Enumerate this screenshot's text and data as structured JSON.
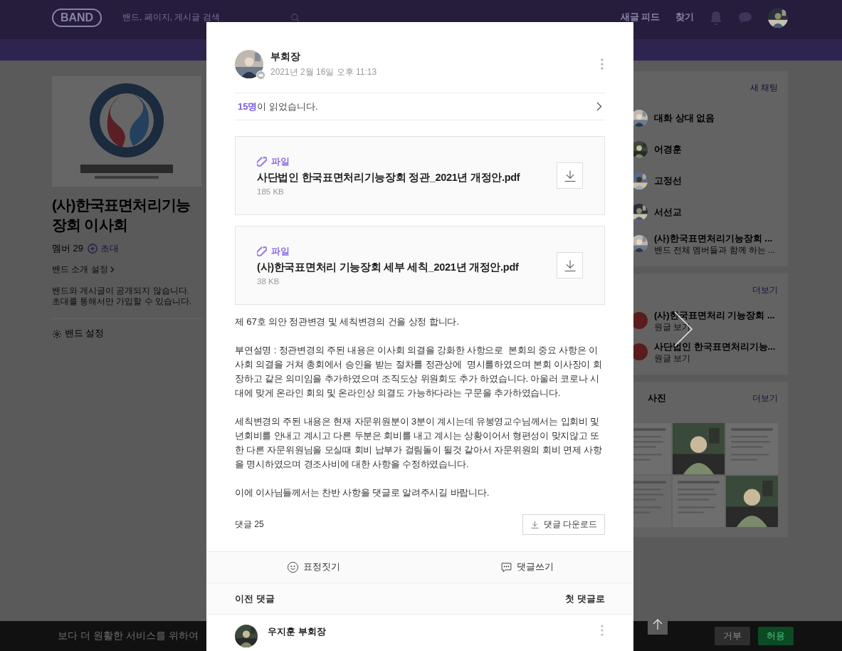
{
  "header": {
    "logo": "BAND",
    "search_placeholder": "밴드, 페이지, 게시글 검색",
    "nav": [
      "새글 피드",
      "찾기"
    ]
  },
  "band": {
    "name": "(사)한국표면처리기능장회 이사회",
    "members": "멤버 29",
    "invite": "초대",
    "intro_link": "밴드 소개 설정",
    "notice": [
      "밴드와 게시글이 공개되지 않습니다.",
      "초대를 통해서만 가입할 수 있습니다."
    ],
    "settings": "밴드 설정"
  },
  "chat": {
    "action": "새 채팅",
    "items": [
      {
        "name": "대화 상대 없음"
      },
      {
        "name": "어경훈"
      },
      {
        "name": "고정선"
      },
      {
        "name": "서선교"
      },
      {
        "name": "(사)한국표면처리기능장회 ...",
        "subtitle": "밴드 전체 멤버들과 함께 하는 ..."
      }
    ]
  },
  "files": {
    "action": "더보기",
    "items": [
      {
        "name": "(사)한국표면처리 기능장회 ...",
        "subtitle": "원글 보기"
      },
      {
        "name": "사단법인 한국표면처리기능...",
        "subtitle": "원글 보기"
      }
    ]
  },
  "photos": {
    "title": "사진",
    "action": "더보기"
  },
  "post": {
    "author": "부회장",
    "date": "2021년 2월 16일 오후 11:13",
    "read_by": "**15명**이 읽었습니다.",
    "files": [
      {
        "label": "파일",
        "name": "사단법인 한국표면처리기능장회 정관_2021년 개정안.pdf",
        "size": "185 KB"
      },
      {
        "label": "파일",
        "name": "(사)한국표면처리 기능장회 세부 세칙_2021년 개정안.pdf",
        "size": "38 KB"
      }
    ],
    "body": [
      "제 67호 의안 정관변경 및 세칙변경의 건을 상정 합니다.",
      "부연설명 : 정관변경의 주된 내용은 이사회 의결을 강화한 사항으로  본회의 중요 사항은 이사회 의결을 거쳐 총회에서 승인을 받는 절차를 정관상에  명시를하였으며 본회 이사장이 회장하고 같은 의미임을 추가하였으며 조직도상 위원회도 추가 하였습니다. 아울러 코로나 시대에 맞게 온라인 회의 및 온라인상 의결도 가능하다라는 구문을 추가하였습니다.",
      "세칙변경의 주된 내용은 현재 자문위원분이 3분이 계시는데 유봉영교수님께서는 입회비 및 년회비를 안내고 계시고 다른 두분은 회비를 내고 계시는 상황이어서 형편성이 맞지않고 또한 다른 자문위원님을 모실때 회비 납부가 걸림돌이 될것 같아서 자문위원의 회비 면제 사항을 명시하였으며 경조사비에 대한 사항을 수정하였습니다.",
      "이에 이사님들께서는 찬반 사항을 댓글로 알려주시길 바랍니다."
    ],
    "comment_count": "댓글 25",
    "download_comments": "댓글 다운로드",
    "actions": [
      {
        "label": "표정짓기",
        "kind": "emotion"
      },
      {
        "label": "댓글쓰기",
        "kind": "comment"
      }
    ],
    "prev_comments": "이전 댓글",
    "first_comment": "첫 댓글로",
    "comments": [
      {
        "author": "우지훈 부회장"
      }
    ]
  },
  "cookie_bar": {
    "text": "보다 더 원활한 서비스를 위하여",
    "buttons": [
      {
        "label": "거부",
        "kind": "decline"
      },
      {
        "label": "허용",
        "kind": "accept"
      }
    ]
  }
}
